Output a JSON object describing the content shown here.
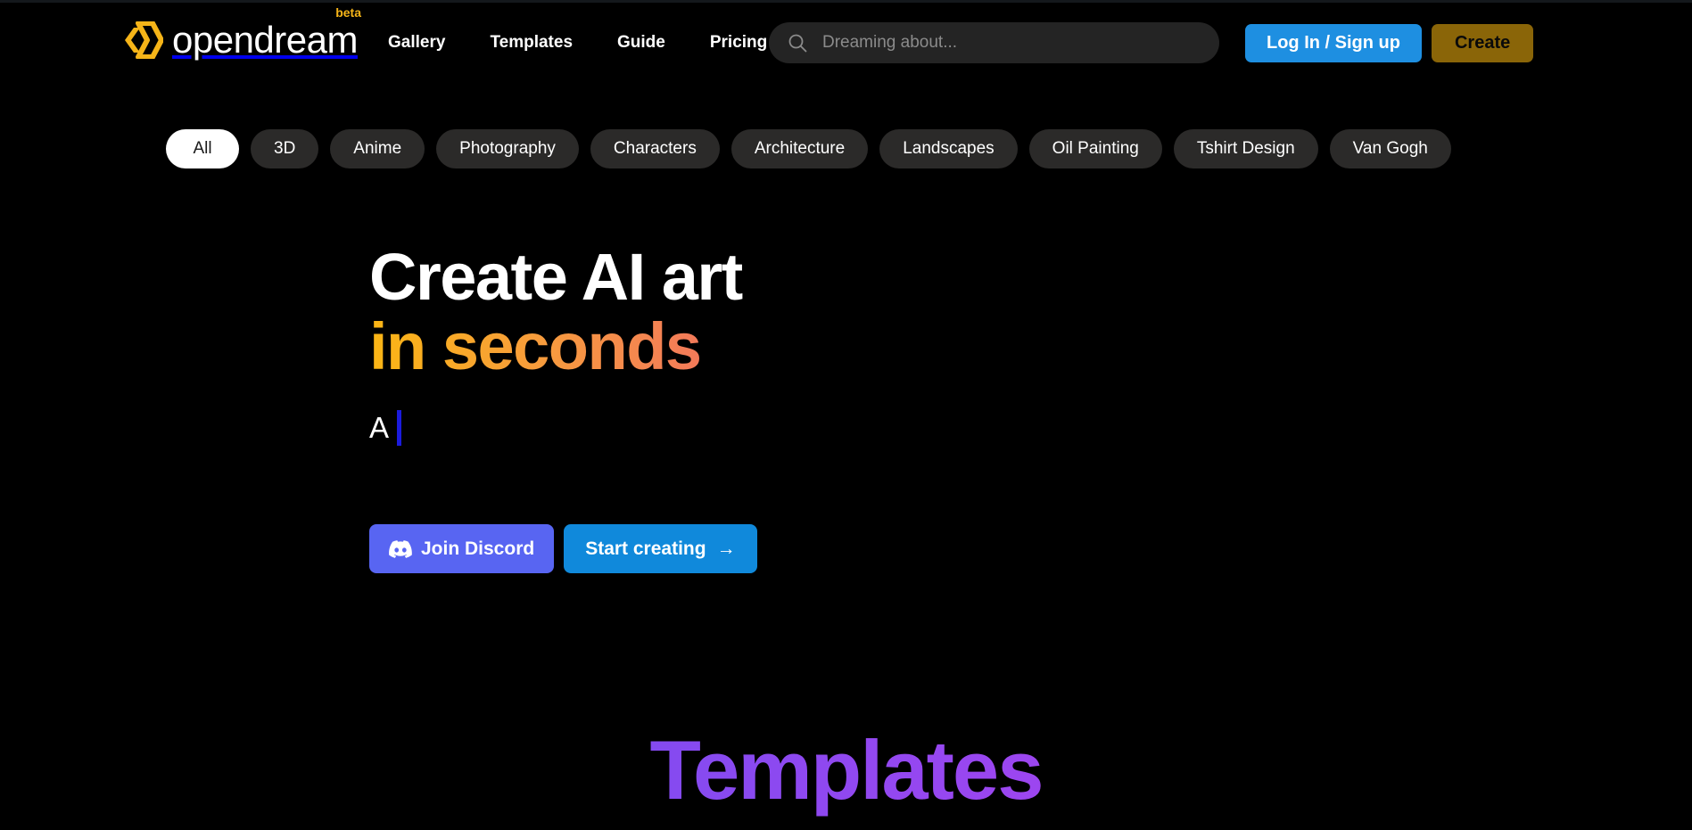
{
  "brand": {
    "name": "opendream",
    "badge": "beta",
    "logo_icon": "hexagon-chevron-logo-icon",
    "logo_color": "#f5b418"
  },
  "nav": {
    "items": [
      {
        "label": "Gallery",
        "name": "nav-gallery"
      },
      {
        "label": "Templates",
        "name": "nav-templates"
      },
      {
        "label": "Guide",
        "name": "nav-guide"
      },
      {
        "label": "Pricing",
        "name": "nav-pricing"
      }
    ]
  },
  "search": {
    "icon": "search-icon",
    "value": "",
    "placeholder": "Dreaming about..."
  },
  "header_actions": {
    "login_label": "Log In / Sign up",
    "login_color": "#1e8fe1",
    "create_label": "Create",
    "create_color": "#8a6508"
  },
  "filters": {
    "active": "All",
    "chips": [
      "All",
      "3D",
      "Anime",
      "Photography",
      "Characters",
      "Architecture",
      "Landscapes",
      "Oil Painting",
      "Tshirt Design",
      "Van Gogh"
    ]
  },
  "hero": {
    "headline_line1": "Create AI art",
    "headline_line2": "in seconds",
    "gradient_start": "#fbb614",
    "gradient_end": "#f03fab",
    "typed_text": "A",
    "cursor_color": "#1b1bdd",
    "cta_discord": "Join Discord",
    "cta_discord_icon": "discord-icon",
    "cta_discord_color": "#5865f2",
    "cta_start": "Start creating",
    "cta_start_arrow": "→",
    "cta_start_color": "#1089db"
  },
  "templates_section": {
    "title": "Templates",
    "gradient_start": "#6d5cf5",
    "gradient_end": "#c04df0"
  }
}
